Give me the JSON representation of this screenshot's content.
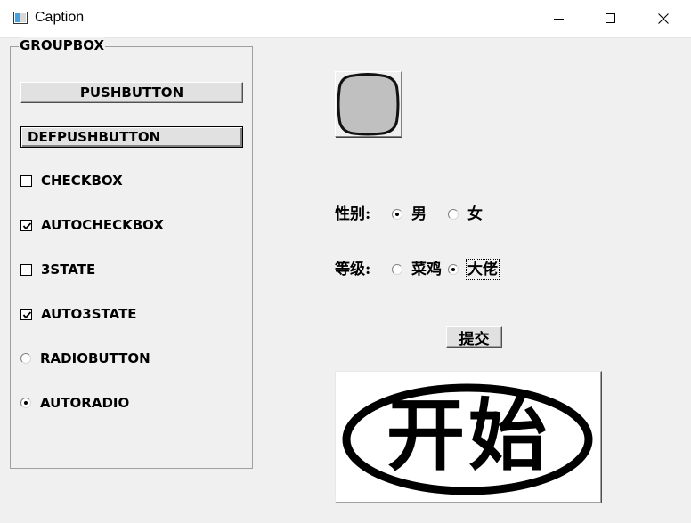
{
  "window": {
    "title": "Caption",
    "icon": "window-app-icon",
    "controls": [
      "minimize-icon",
      "maximize-icon",
      "close-icon"
    ]
  },
  "groupbox": {
    "label": "GROUPBOX",
    "pushbutton": "PUSHBUTTON",
    "defpushbutton": "DEFPUSHBUTTON",
    "checkbox": {
      "label": "CHECKBOX",
      "checked": false
    },
    "autocheckbox": {
      "label": "AUTOCHECKBOX",
      "checked": true
    },
    "threestate": {
      "label": "3STATE",
      "checked": false
    },
    "autothreestate": {
      "label": "AUTO3STATE",
      "checked": true
    },
    "radiobutton": {
      "label": "RADIOBUTTON",
      "selected": false
    },
    "autoradio": {
      "label": "AUTORADIO",
      "selected": true
    }
  },
  "image_button": {
    "icon": "rounded-square-icon",
    "fill": "#c0c0c0"
  },
  "gender": {
    "label": "性别:",
    "options": [
      {
        "label": "男",
        "selected": true
      },
      {
        "label": "女",
        "selected": false
      }
    ]
  },
  "level": {
    "label": "等级:",
    "options": [
      {
        "label": "菜鸡",
        "selected": false
      },
      {
        "label": "大佬",
        "selected": true
      }
    ]
  },
  "submit_label": "提交",
  "start_button": {
    "label": "开始",
    "icon": "start-oval-icon"
  }
}
